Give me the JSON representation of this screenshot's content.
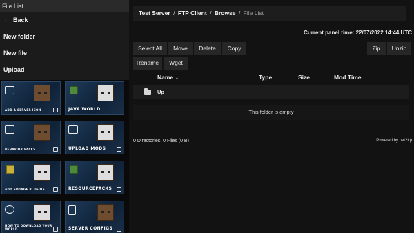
{
  "sidebar": {
    "title": "File List",
    "back_label": "Back",
    "new_folder_label": "New folder",
    "new_file_label": "New file",
    "upload_label": "Upload",
    "tiles": [
      {
        "caption": "Add a server icon"
      },
      {
        "caption": "Java world"
      },
      {
        "caption": "Behavior packs"
      },
      {
        "caption": "Upload mods"
      },
      {
        "caption": "Add sponge plugins"
      },
      {
        "caption": "Resourcepacks"
      },
      {
        "caption": "How to download your world"
      },
      {
        "caption": "Server configs"
      }
    ]
  },
  "breadcrumb": {
    "items": [
      "Test Server",
      "FTP Client",
      "Browse"
    ],
    "separator": "/",
    "current": "File List"
  },
  "panel_time": "Current panel time: 22/07/2022 14:44 UTC",
  "toolbar": {
    "select_all": "Select All",
    "move": "Move",
    "delete": "Delete",
    "copy": "Copy",
    "zip": "Zip",
    "unzip": "Unzip",
    "rename": "Rename",
    "wget": "Wget"
  },
  "table": {
    "columns": {
      "name": "Name",
      "type": "Type",
      "size": "Size",
      "mod_time": "Mod Time"
    },
    "sort_indicator": "▲",
    "up_label": "Up",
    "empty_message": "This folder is empty"
  },
  "footer": {
    "summary": "0 Directories, 0 Files (0 B)",
    "powered_by": "Powered by net2ftp"
  }
}
